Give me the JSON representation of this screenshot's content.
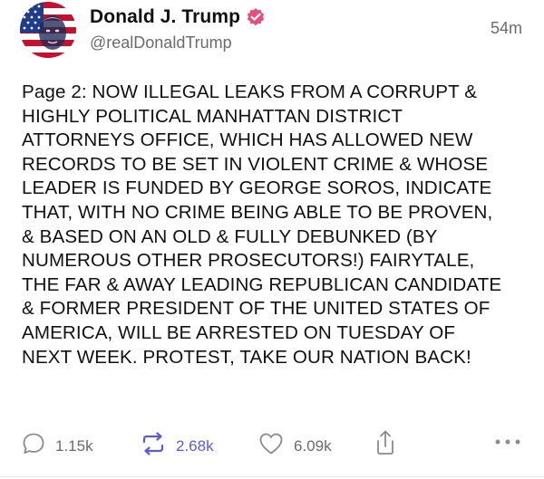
{
  "author": {
    "display_name": "Donald J. Trump",
    "handle": "@realDonaldTrump",
    "verified_color": "#e64f7a",
    "avatar_icon": "flag-portrait-avatar"
  },
  "post": {
    "timestamp": "54m",
    "lines": [
      "Page 2: NOW ILLEGAL LEAKS FROM A CORRUPT &",
      "HIGHLY POLITICAL MANHATTAN DISTRICT",
      "ATTORNEYS OFFICE, WHICH HAS ALLOWED NEW",
      "RECORDS TO BE SET IN VIOLENT CRIME & WHOSE",
      "LEADER IS FUNDED BY GEORGE SOROS, INDICATE",
      "THAT, WITH NO CRIME BEING ABLE TO BE PROVEN,",
      "& BASED ON AN OLD & FULLY DEBUNKED (BY",
      "NUMEROUS OTHER PROSECUTORS!) FAIRYTALE,",
      "THE FAR & AWAY LEADING REPUBLICAN CANDIDATE",
      "& FORMER PRESIDENT OF THE UNITED STATES OF",
      "AMERICA, WILL BE ARRESTED ON TUESDAY OF",
      "NEXT WEEK. PROTEST, TAKE OUR NATION BACK!"
    ]
  },
  "actions": {
    "replies": "1.15k",
    "reblogs": "2.68k",
    "likes": "6.09k",
    "icons": [
      "comment-icon",
      "reblog-icon",
      "heart-icon",
      "share-icon",
      "more-icon"
    ],
    "reblog_color": "#5b5bd6",
    "icon_color": "#8a8a8a"
  }
}
